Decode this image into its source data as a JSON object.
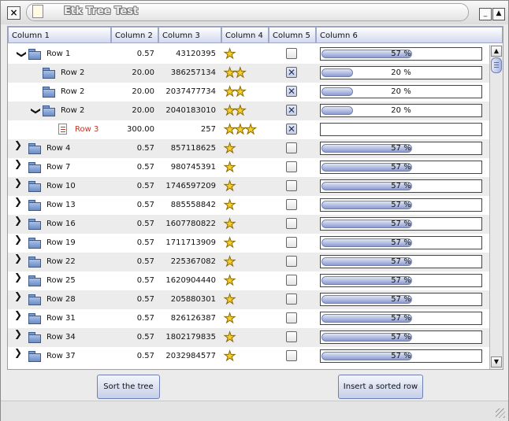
{
  "window": {
    "title": "Etk Tree Test"
  },
  "columns": [
    "Column 1",
    "Column 2",
    "Column 3",
    "Column 4",
    "Column 5",
    "Column 6"
  ],
  "rows": [
    {
      "label": "Row 1",
      "level": 0,
      "expander": "open",
      "icon": "folder",
      "c2": "0.57",
      "c3": "43120395",
      "stars": 1,
      "checked": false,
      "progress_text": "57 %",
      "progress": 0.57
    },
    {
      "label": "Row 2",
      "level": 1,
      "expander": "none",
      "icon": "folder",
      "c2": "20.00",
      "c3": "386257134",
      "stars": 2,
      "checked": true,
      "progress_text": "20 %",
      "progress": 0.2
    },
    {
      "label": "Row 2",
      "level": 1,
      "expander": "none",
      "icon": "folder",
      "c2": "20.00",
      "c3": "2037477734",
      "stars": 2,
      "checked": true,
      "progress_text": "20 %",
      "progress": 0.2
    },
    {
      "label": "Row 2",
      "level": 1,
      "expander": "open",
      "icon": "folder",
      "c2": "20.00",
      "c3": "2040183010",
      "stars": 2,
      "checked": true,
      "progress_text": "20 %",
      "progress": 0.2
    },
    {
      "label": "Row 3",
      "level": 2,
      "expander": "none",
      "icon": "document",
      "c2": "300.00",
      "c3": "257",
      "stars": 3,
      "checked": true,
      "progress_text": "",
      "progress": 0,
      "label_color": "#c0392b"
    },
    {
      "label": "Row 4",
      "level": 0,
      "expander": "closed",
      "icon": "folder",
      "c2": "0.57",
      "c3": "857118625",
      "stars": 1,
      "checked": false,
      "progress_text": "57 %",
      "progress": 0.57
    },
    {
      "label": "Row 7",
      "level": 0,
      "expander": "closed",
      "icon": "folder",
      "c2": "0.57",
      "c3": "980745391",
      "stars": 1,
      "checked": false,
      "progress_text": "57 %",
      "progress": 0.57
    },
    {
      "label": "Row 10",
      "level": 0,
      "expander": "closed",
      "icon": "folder",
      "c2": "0.57",
      "c3": "1746597209",
      "stars": 1,
      "checked": false,
      "progress_text": "57 %",
      "progress": 0.57
    },
    {
      "label": "Row 13",
      "level": 0,
      "expander": "closed",
      "icon": "folder",
      "c2": "0.57",
      "c3": "885558842",
      "stars": 1,
      "checked": false,
      "progress_text": "57 %",
      "progress": 0.57
    },
    {
      "label": "Row 16",
      "level": 0,
      "expander": "closed",
      "icon": "folder",
      "c2": "0.57",
      "c3": "1607780822",
      "stars": 1,
      "checked": false,
      "progress_text": "57 %",
      "progress": 0.57
    },
    {
      "label": "Row 19",
      "level": 0,
      "expander": "closed",
      "icon": "folder",
      "c2": "0.57",
      "c3": "1711713909",
      "stars": 1,
      "checked": false,
      "progress_text": "57 %",
      "progress": 0.57
    },
    {
      "label": "Row 22",
      "level": 0,
      "expander": "closed",
      "icon": "folder",
      "c2": "0.57",
      "c3": "225367082",
      "stars": 1,
      "checked": false,
      "progress_text": "57 %",
      "progress": 0.57
    },
    {
      "label": "Row 25",
      "level": 0,
      "expander": "closed",
      "icon": "folder",
      "c2": "0.57",
      "c3": "1620904440",
      "stars": 1,
      "checked": false,
      "progress_text": "57 %",
      "progress": 0.57
    },
    {
      "label": "Row 28",
      "level": 0,
      "expander": "closed",
      "icon": "folder",
      "c2": "0.57",
      "c3": "205880301",
      "stars": 1,
      "checked": false,
      "progress_text": "57 %",
      "progress": 0.57
    },
    {
      "label": "Row 31",
      "level": 0,
      "expander": "closed",
      "icon": "folder",
      "c2": "0.57",
      "c3": "826126387",
      "stars": 1,
      "checked": false,
      "progress_text": "57 %",
      "progress": 0.57
    },
    {
      "label": "Row 34",
      "level": 0,
      "expander": "closed",
      "icon": "folder",
      "c2": "0.57",
      "c3": "1802179835",
      "stars": 1,
      "checked": false,
      "progress_text": "57 %",
      "progress": 0.57
    },
    {
      "label": "Row 37",
      "level": 0,
      "expander": "closed",
      "icon": "folder",
      "c2": "0.57",
      "c3": "2032984577",
      "stars": 1,
      "checked": false,
      "progress_text": "57 %",
      "progress": 0.57
    }
  ],
  "buttons": {
    "sort": "Sort the tree",
    "insert": "Insert a sorted row"
  },
  "icons": {
    "close": "×",
    "doc": "document-icon",
    "minimize": "_",
    "maximize": "▲",
    "scroll_up": "▲",
    "scroll_down": "▼",
    "star": "★",
    "check": "✕",
    "expander_open": "❯",
    "expander_closed": "❯"
  },
  "colors": {
    "accent": "#c6cfe9",
    "progress_fill": "#8a9bd0",
    "leaf_label": "#c0392b"
  }
}
